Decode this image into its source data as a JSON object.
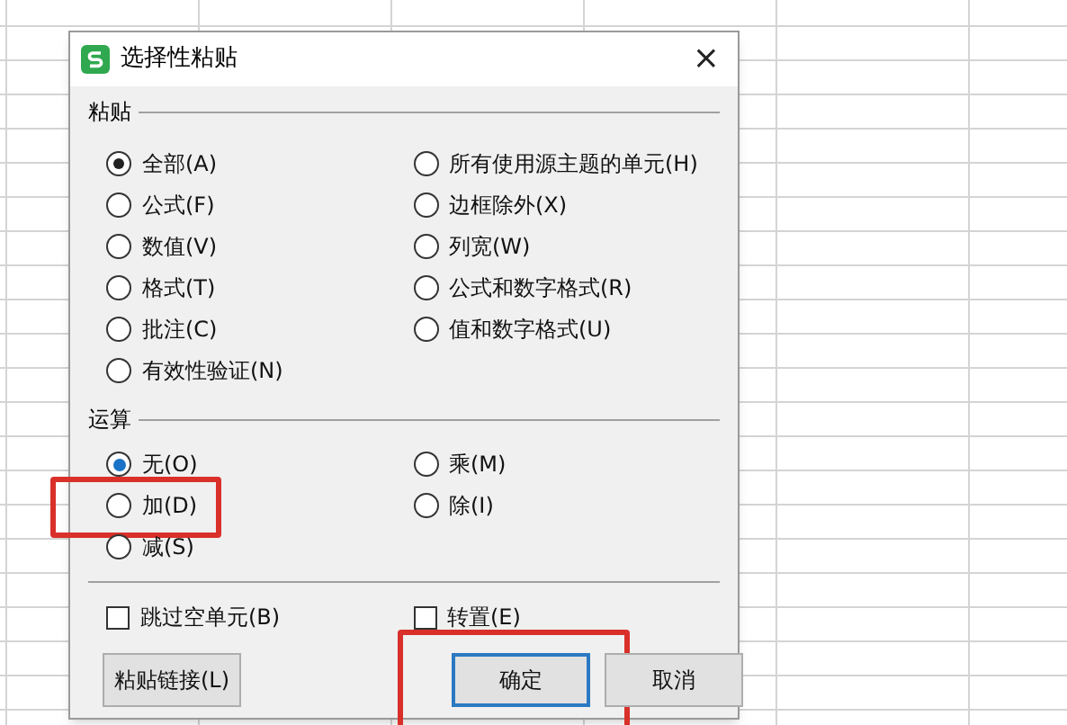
{
  "window": {
    "title": "选择性粘贴",
    "close": "×"
  },
  "paste": {
    "title": "粘贴",
    "columns": [
      [
        {
          "label": "全部(A)",
          "selected": true
        },
        {
          "label": "公式(F)",
          "selected": false
        },
        {
          "label": "数值(V)",
          "selected": false
        },
        {
          "label": "格式(T)",
          "selected": false
        },
        {
          "label": "批注(C)",
          "selected": false
        },
        {
          "label": "有效性验证(N)",
          "selected": false
        }
      ],
      [
        {
          "label": "所有使用源主题的单元(H)",
          "selected": false
        },
        {
          "label": "边框除外(X)",
          "selected": false
        },
        {
          "label": "列宽(W)",
          "selected": false
        },
        {
          "label": "公式和数字格式(R)",
          "selected": false
        },
        {
          "label": "值和数字格式(U)",
          "selected": false
        }
      ]
    ]
  },
  "operation": {
    "title": "运算",
    "columns": [
      [
        {
          "label": "无(O)",
          "selected": true,
          "highlighted": false
        },
        {
          "label": "加(D)",
          "selected": false,
          "highlighted": true
        },
        {
          "label": "减(S)",
          "selected": false,
          "highlighted": false
        }
      ],
      [
        {
          "label": "乘(M)",
          "selected": false,
          "highlighted": false
        },
        {
          "label": "除(I)",
          "selected": false,
          "highlighted": false
        }
      ]
    ]
  },
  "checkboxes": [
    {
      "label": "跳过空单元(B)",
      "checked": false
    },
    {
      "label": "转置(E)",
      "checked": false
    }
  ],
  "buttons": [
    {
      "label": "粘贴链接(L)",
      "focused": false,
      "highlighted": false
    },
    {
      "label": "确定",
      "focused": true,
      "highlighted": true
    },
    {
      "label": "取消",
      "focused": false,
      "highlighted": false
    }
  ]
}
